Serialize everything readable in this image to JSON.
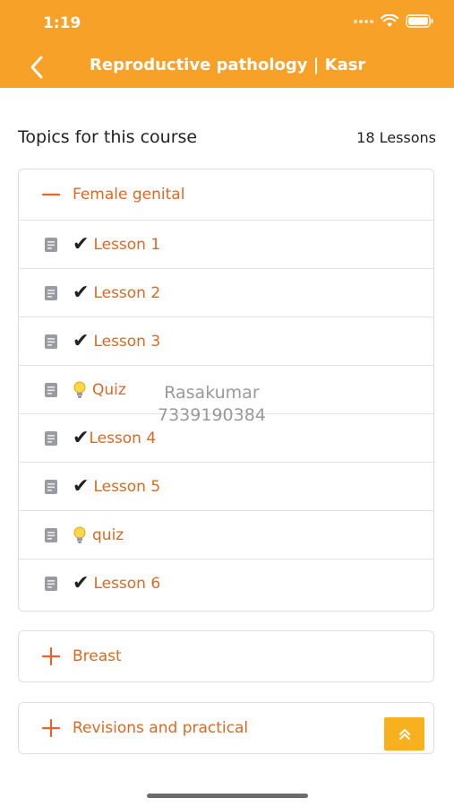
{
  "status_bar": {
    "time": "1:19"
  },
  "header": {
    "title": "Reproductive pathology | Kasr"
  },
  "course": {
    "topics_title": "Topics for this course",
    "lessons_count": "18 Lessons"
  },
  "sections": [
    {
      "title": "Female genital",
      "expanded": true,
      "lessons": [
        {
          "label": "Lesson 1",
          "status": "completed"
        },
        {
          "label": "Lesson 2",
          "status": "completed"
        },
        {
          "label": "Lesson 3",
          "status": "completed"
        },
        {
          "label": "Quiz",
          "status": "quiz"
        },
        {
          "label": "Lesson 4",
          "status": "completed"
        },
        {
          "label": "Lesson 5",
          "status": "completed"
        },
        {
          "label": "quiz",
          "status": "quiz"
        },
        {
          "label": "Lesson 6",
          "status": "completed"
        }
      ]
    },
    {
      "title": "Breast",
      "expanded": false
    },
    {
      "title": "Revisions and practical",
      "expanded": false
    }
  ],
  "watermark": {
    "name": "Rasakumar",
    "phone": "7339190384"
  },
  "colors": {
    "header": "#f7a129",
    "accent_text": "#d86a25",
    "scroll_button": "#f7b11e"
  }
}
